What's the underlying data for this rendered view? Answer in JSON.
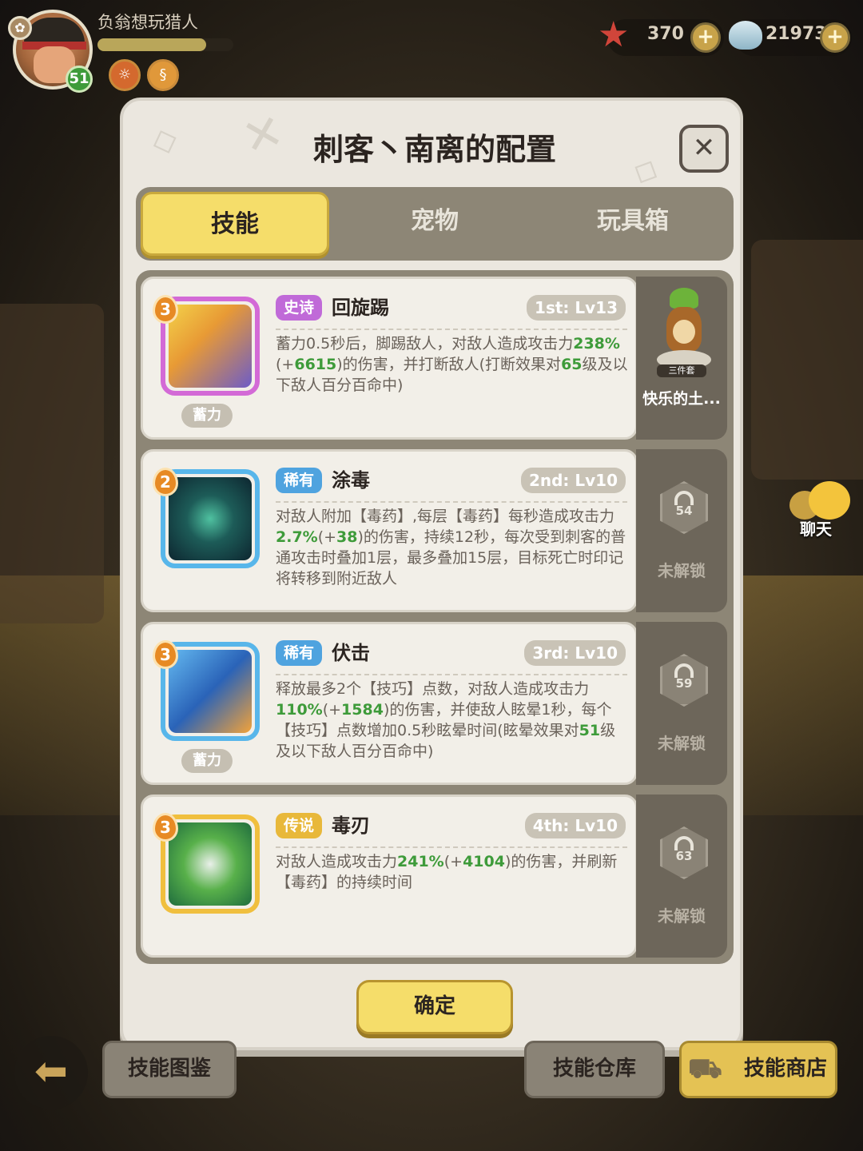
{
  "player": {
    "name": "负翁想玩猎人",
    "level": "51",
    "xp_fraction": 0.8
  },
  "resources": {
    "starfish_count": "370",
    "shell_count": "219732"
  },
  "dialog": {
    "title": "刺客丶南离的配置",
    "close_label": "✕",
    "tabs": [
      "技能",
      "宠物",
      "玩具箱"
    ],
    "active_tab": 0,
    "confirm_label": "确定"
  },
  "skills": [
    {
      "stars": "3",
      "charge_tag": "蓄力",
      "rarity": "史诗",
      "rarity_color": "#c06ad8",
      "name": "回旋踢",
      "slot": "1st: Lv13",
      "frame_color": "#d36ad6",
      "desc_parts": [
        "蓄力0.5秒后，脚踢敌人，对敌人造成攻击力",
        "238%",
        "(+",
        "6615",
        ")的伤害，并打断敌人(打断效果对",
        "65",
        "级及以下敌人百分百命中)"
      ]
    },
    {
      "stars": "2",
      "charge_tag": "",
      "rarity": "稀有",
      "rarity_color": "#4fa3df",
      "name": "涂毒",
      "slot": "2nd: Lv10",
      "frame_color": "#58b6ea",
      "desc_parts": [
        "对敌人附加【毒药】,每层【毒药】每秒造成攻击力",
        "2.7%",
        "(+",
        "38",
        ")的伤害，持续12秒，每次受到刺客的普通攻击时叠加1层，最多叠加15层，目标死亡时印记将转移到附近敌人",
        "",
        ""
      ]
    },
    {
      "stars": "3",
      "charge_tag": "蓄力",
      "rarity": "稀有",
      "rarity_color": "#4fa3df",
      "name": "伏击",
      "slot": "3rd: Lv10",
      "frame_color": "#58b6ea",
      "desc_parts": [
        "释放最多2个【技巧】点数，对敌人造成攻击力",
        "110%",
        "(+",
        "1584",
        ")的伤害，并使敌人眩晕1秒，每个【技巧】点数增加0.5秒眩晕时间(眩晕效果对",
        "51",
        "级及以下敌人百分百命中)"
      ]
    },
    {
      "stars": "3",
      "charge_tag": "",
      "rarity": "传说",
      "rarity_color": "#e8b83a",
      "name": "毒刃",
      "slot": "4th: Lv10",
      "frame_color": "#f0bf3e",
      "desc_parts": [
        "对敌人造成攻击力",
        "241%",
        "(+",
        "4104",
        ")的伤害，并刷新【毒药】的持续时间",
        "",
        ""
      ]
    }
  ],
  "side_slots": [
    {
      "type": "pet",
      "label": "快乐的土...",
      "tag": "三件套"
    },
    {
      "type": "locked",
      "level": "54",
      "label": "未解锁"
    },
    {
      "type": "locked",
      "level": "59",
      "label": "未解锁"
    },
    {
      "type": "locked",
      "level": "63",
      "label": "未解锁"
    }
  ],
  "bottom": {
    "back_label": "⬅",
    "catalog_label": "技能图鉴",
    "storage_label": "技能仓库",
    "shop_label": "技能商店"
  },
  "chat_label": "聊天"
}
